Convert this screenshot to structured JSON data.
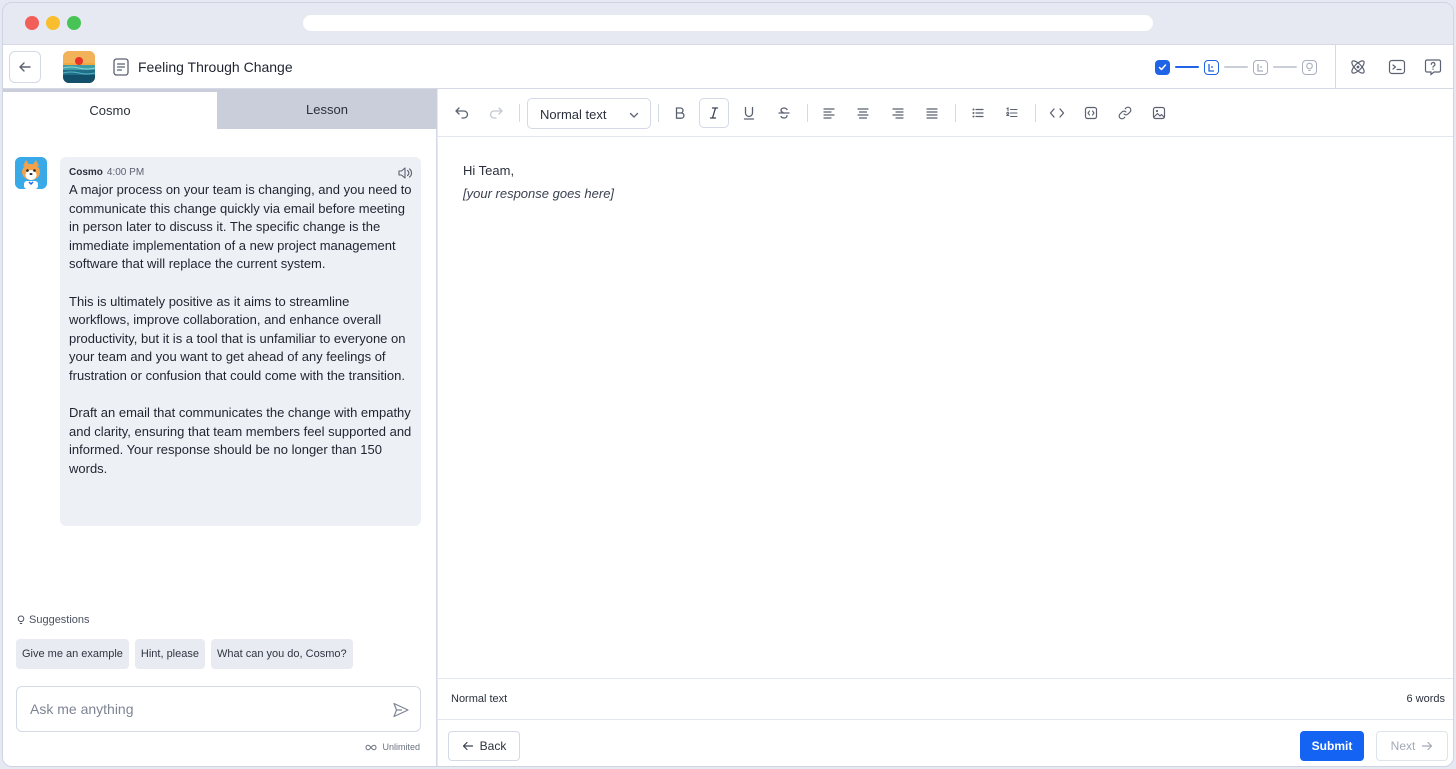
{
  "window": {
    "controls": [
      "close",
      "minimize",
      "maximize"
    ]
  },
  "header": {
    "title": "Feeling Through Change",
    "back_icon": "arrow-left-icon",
    "progress_steps": [
      "done",
      "active",
      "todo",
      "todo"
    ],
    "right_icons": [
      "atom-icon",
      "terminal-icon",
      "help-icon"
    ]
  },
  "left_panel": {
    "tabs": [
      {
        "label": "Cosmo",
        "active": true
      },
      {
        "label": "Lesson",
        "active": false
      }
    ],
    "message": {
      "author": "Cosmo",
      "time": "4:00 PM",
      "text": "A major process on your team is changing, and you need to communicate this change quickly via email before meeting in person later to discuss it. The specific change is the immediate implementation of a new project management software that will replace the current system.\n\nThis is ultimately positive as it aims to streamline workflows, improve collaboration, and enhance overall productivity, but it is a tool that is unfamiliar to everyone on your team and you want to get ahead of any feelings of frustration or confusion that could come with the transition.\n\nDraft an email that communicates the change with empathy and clarity, ensuring that team members feel supported and informed. Your response should be no longer than 150 words."
    },
    "suggestions_label": "Suggestions",
    "suggestions": [
      "Give me an example",
      "Hint, please",
      "What can you do, Cosmo?"
    ],
    "input_placeholder": "Ask me anything",
    "limit_label": "Unlimited"
  },
  "editor": {
    "style_select": "Normal text",
    "content_line1": "Hi Team,",
    "content_line2": "[your response goes here]",
    "status_left": "Normal text",
    "status_right": "6 words",
    "back_label": "Back",
    "submit_label": "Submit",
    "next_label": "Next"
  },
  "colors": {
    "accent": "#1463f3",
    "bubble": "#edf0f5",
    "tab_bar": "#c9ceda"
  }
}
